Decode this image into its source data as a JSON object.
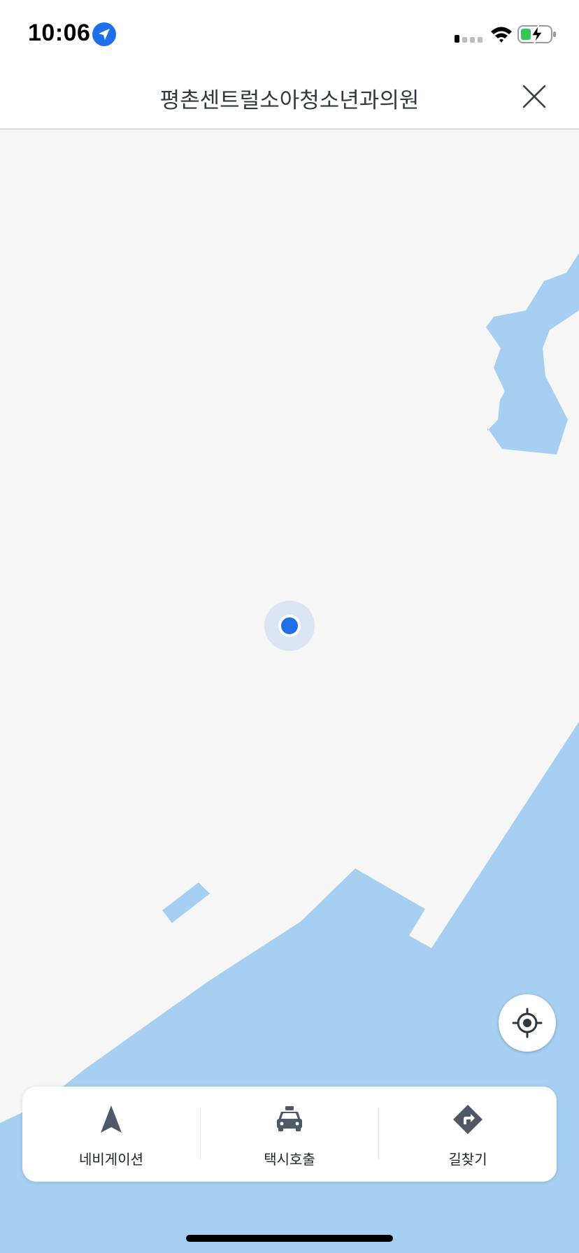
{
  "status_bar": {
    "time": "10:06",
    "icons": [
      "location-arrow-icon",
      "cellular-signal-icon",
      "wifi-icon",
      "battery-charging-icon"
    ]
  },
  "header": {
    "title": "평촌센트럴소아청소년과의원",
    "close_icon": "close-icon"
  },
  "map": {
    "water_color": "#a6cff1",
    "land_color": "#f6f6f6",
    "user_location_color": "#1f6fe8"
  },
  "actions": [
    {
      "label": "네비게이션",
      "icon": "navigation-arrow-icon"
    },
    {
      "label": "택시호출",
      "icon": "taxi-icon"
    },
    {
      "label": "길찾기",
      "icon": "directions-icon"
    }
  ],
  "colors": {
    "accent": "#1f6fe8",
    "icon_gray": "#4e5968",
    "text": "#1f2329"
  }
}
